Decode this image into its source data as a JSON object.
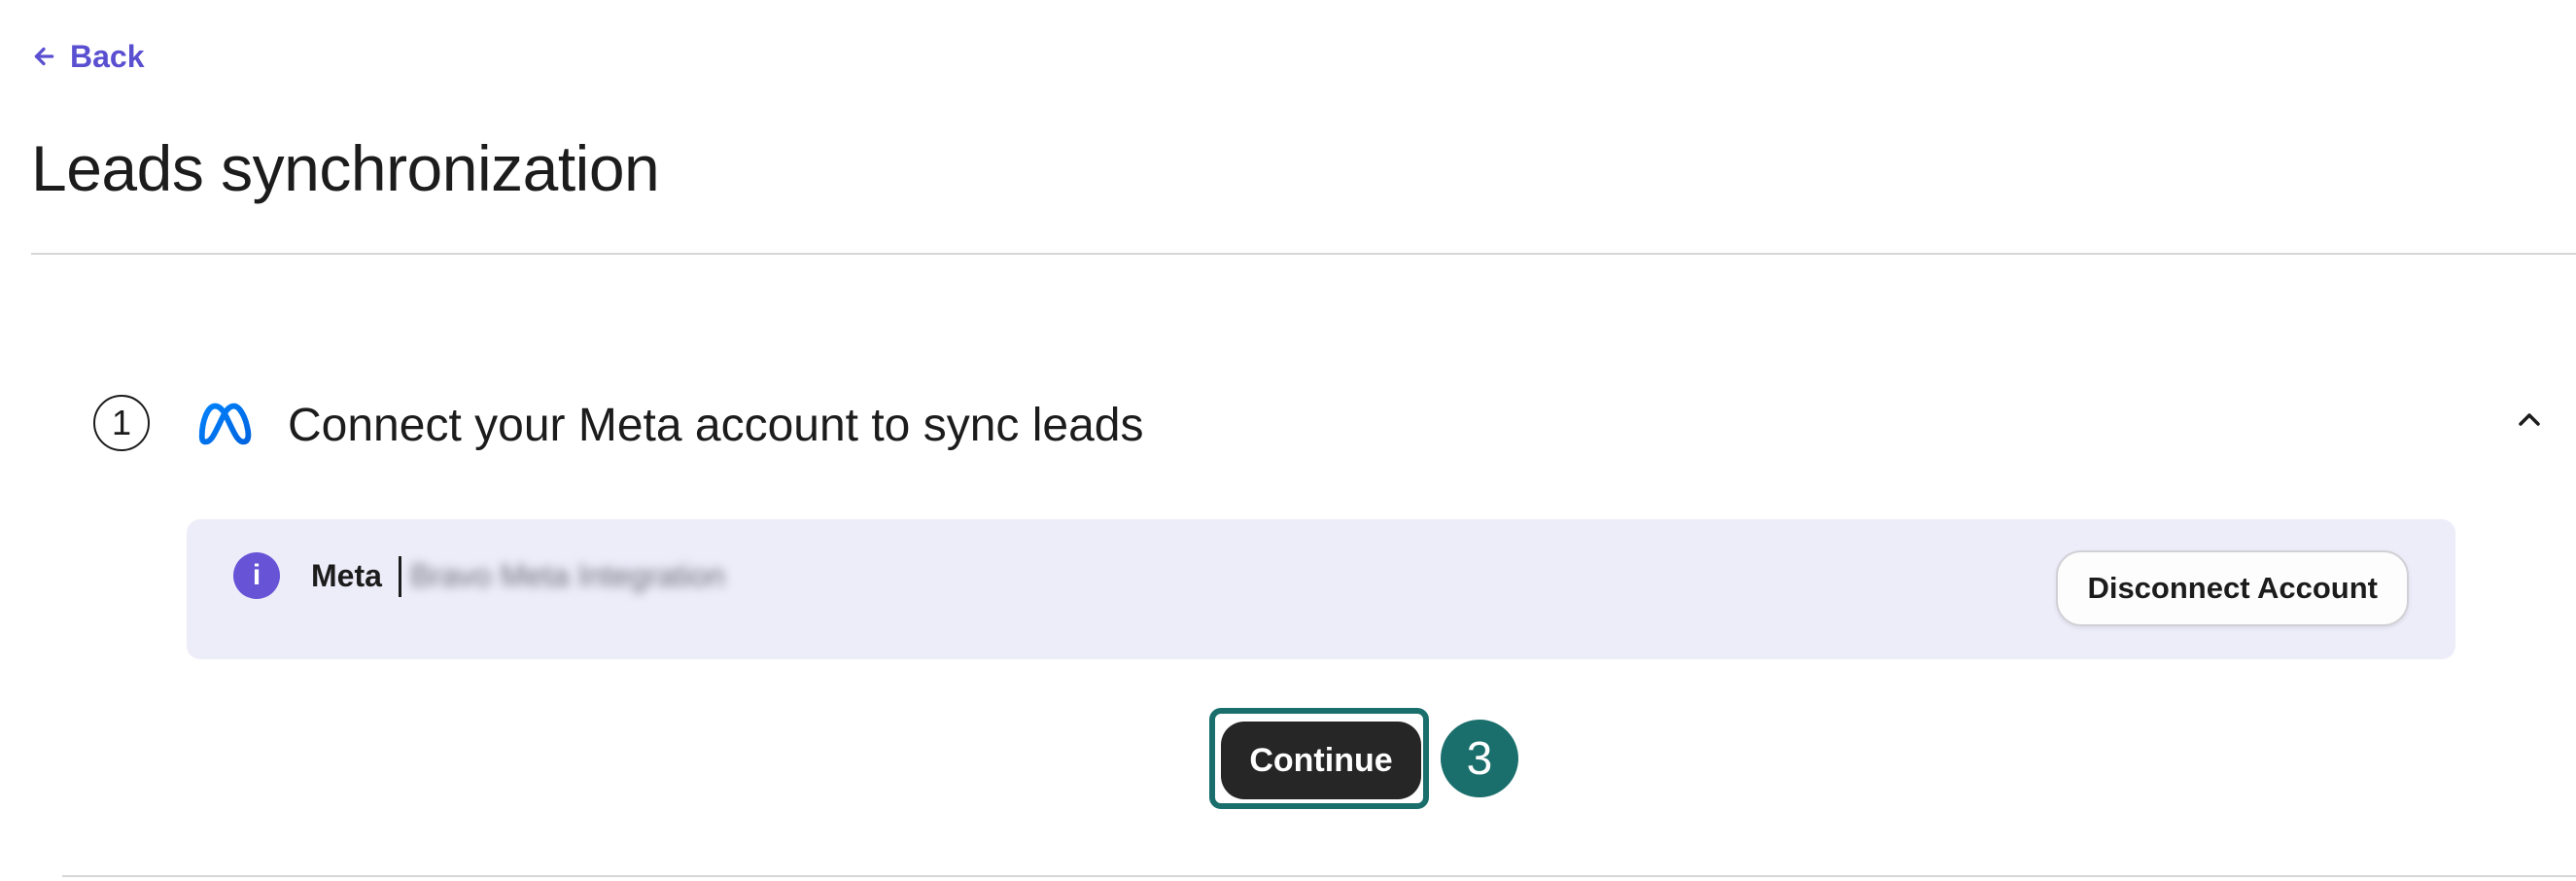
{
  "nav": {
    "back_label": "Back"
  },
  "page": {
    "title": "Leads synchronization"
  },
  "step": {
    "number": "1",
    "title": "Connect your Meta account to sync leads",
    "collapse_icon": "chevron-up-icon"
  },
  "banner": {
    "icon": "info-icon",
    "icon_glyph": "i",
    "account_label": "Meta",
    "account_name": "Bravo Meta Integration",
    "disconnect_label": "Disconnect Account"
  },
  "actions": {
    "continue_label": "Continue"
  },
  "annotation": {
    "marker_number": "3"
  },
  "colors": {
    "accent": "#5a4fd0",
    "info_icon_bg": "#6653d6",
    "banner_bg": "#edecf9",
    "marker_teal": "#1a6f6c",
    "button_dark": "#262626",
    "meta_blue": "#0668e1"
  }
}
